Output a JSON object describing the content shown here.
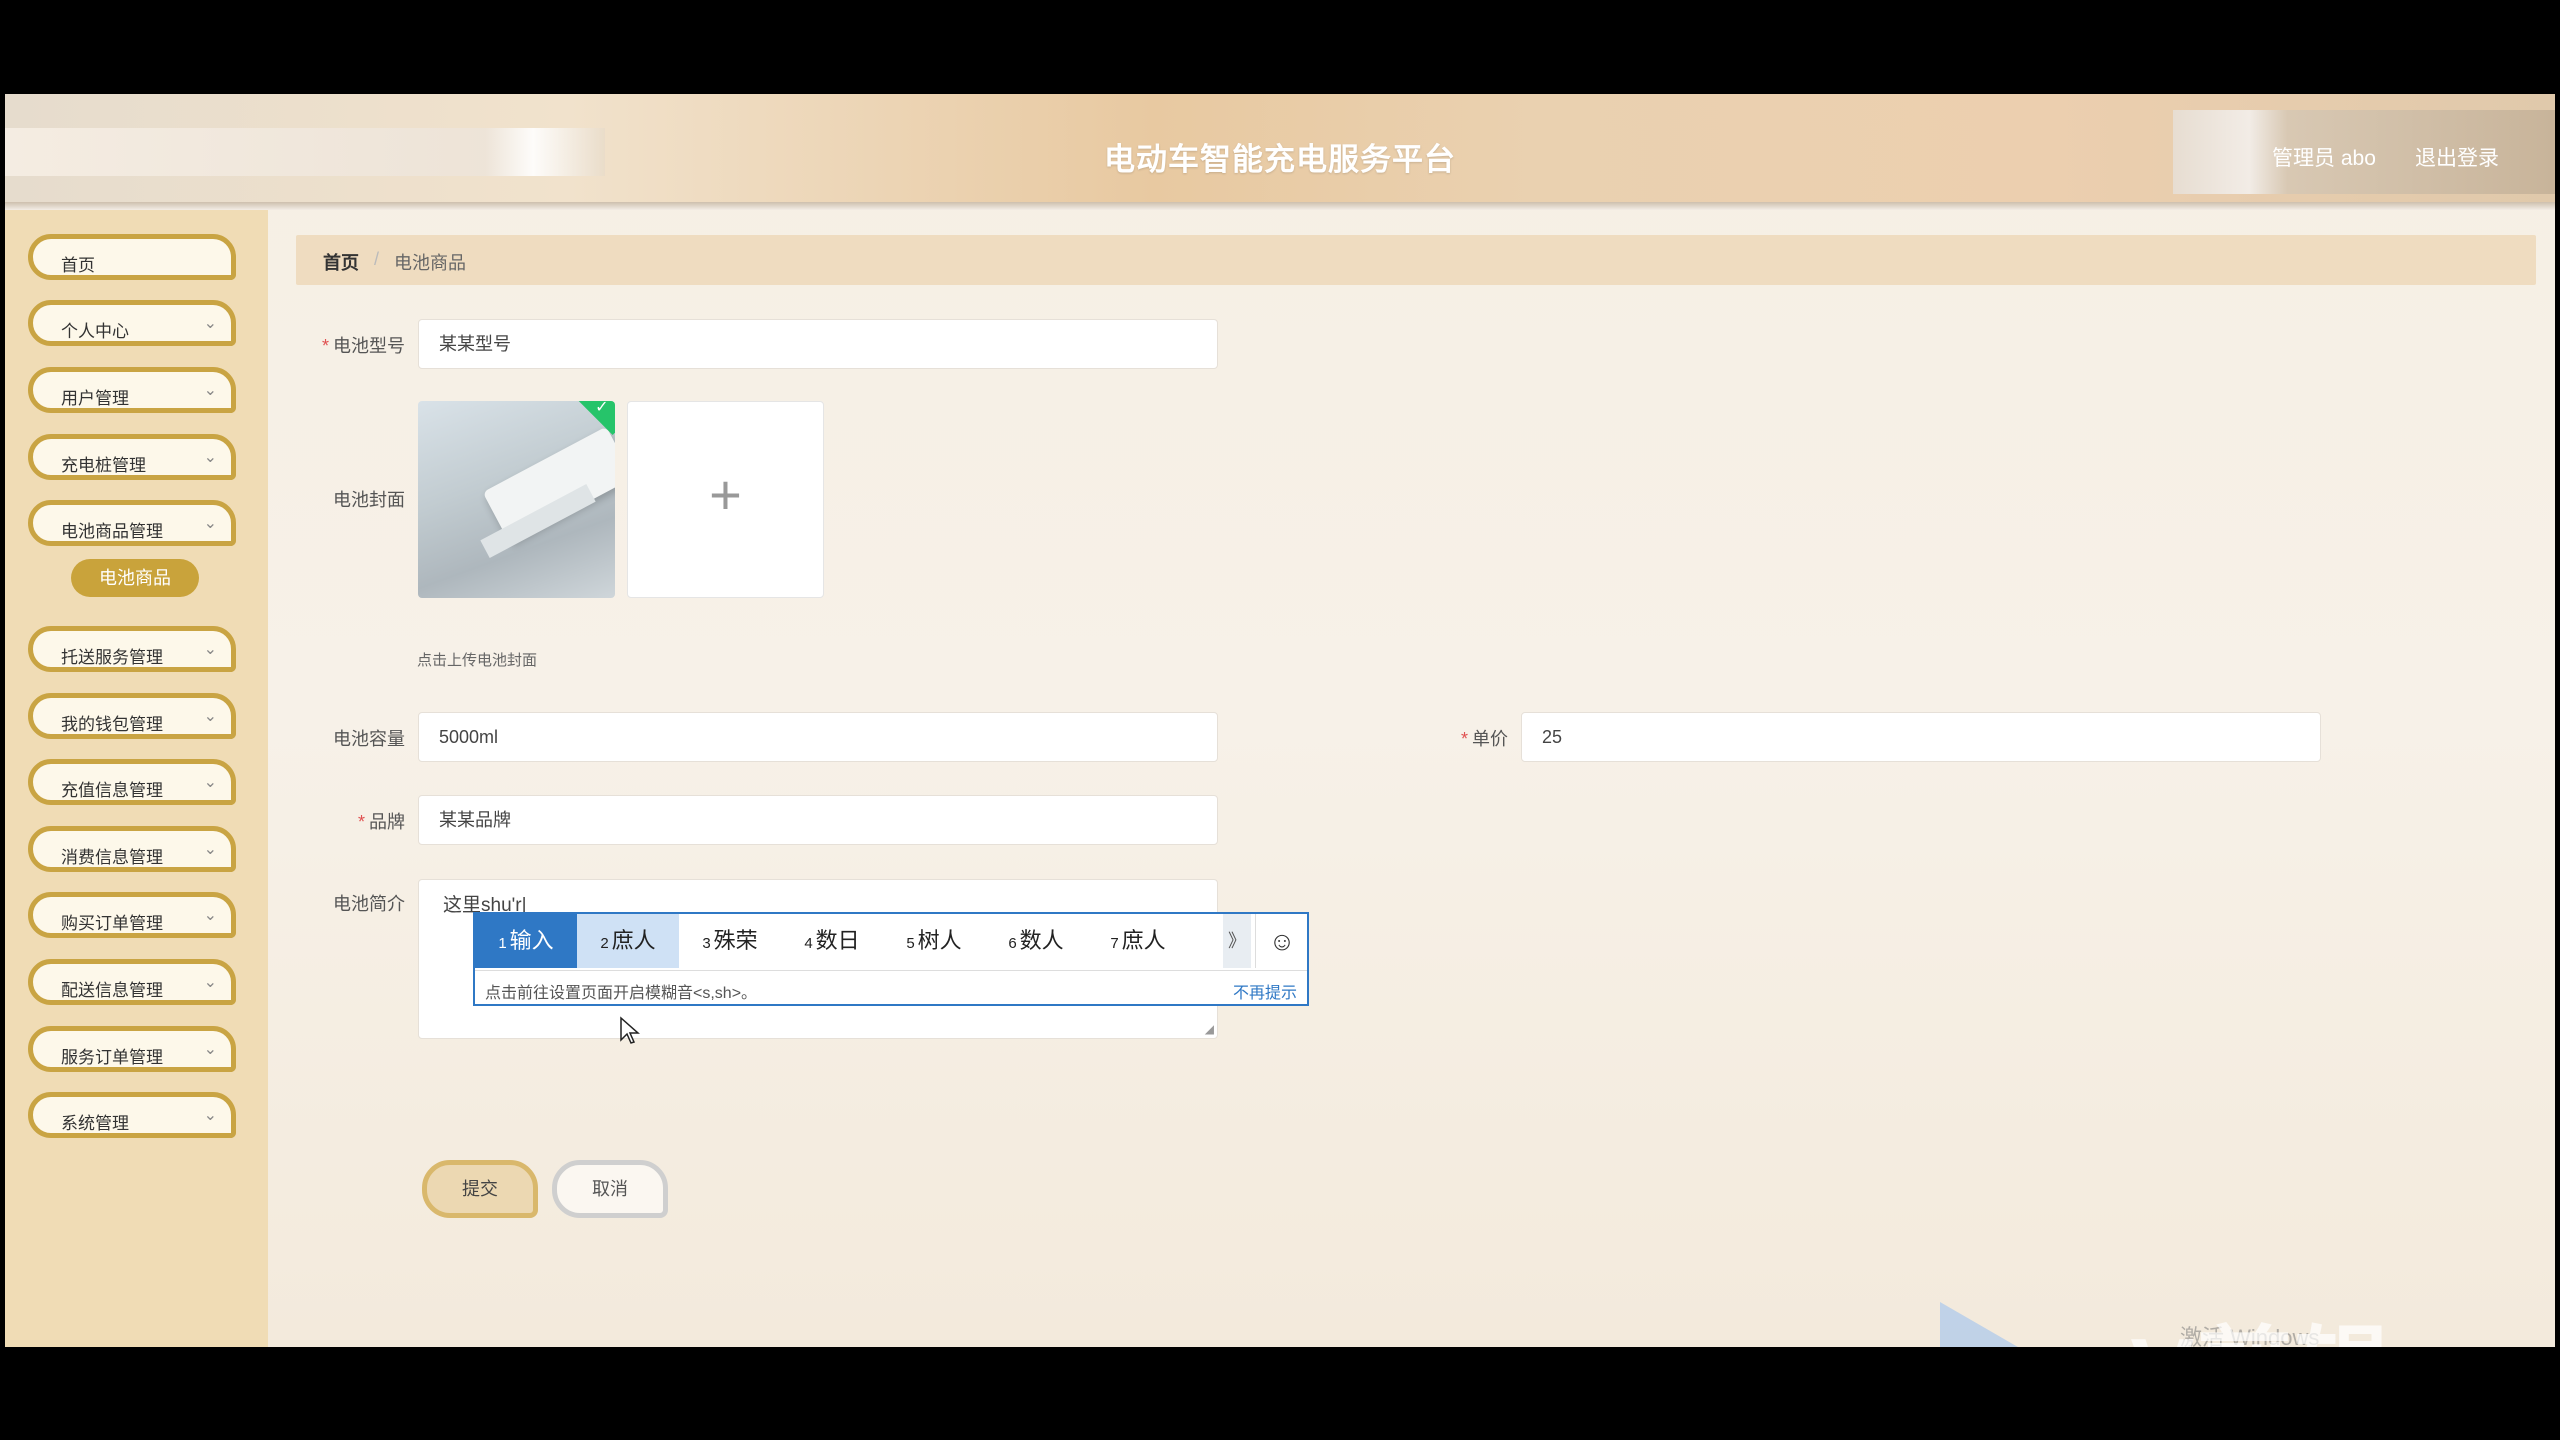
{
  "header": {
    "title": "电动车智能充电服务平台",
    "admin_label": "管理员 abo",
    "logout_label": "退出登录"
  },
  "sidebar": {
    "items": [
      {
        "label": "首页",
        "expandable": false
      },
      {
        "label": "个人中心",
        "expandable": true
      },
      {
        "label": "用户管理",
        "expandable": true
      },
      {
        "label": "充电桩管理",
        "expandable": true
      },
      {
        "label": "电池商品管理",
        "expandable": true
      },
      {
        "label": "托送服务管理",
        "expandable": true
      },
      {
        "label": "我的钱包管理",
        "expandable": true
      },
      {
        "label": "充值信息管理",
        "expandable": true
      },
      {
        "label": "消费信息管理",
        "expandable": true
      },
      {
        "label": "购买订单管理",
        "expandable": true
      },
      {
        "label": "配送信息管理",
        "expandable": true
      },
      {
        "label": "服务订单管理",
        "expandable": true
      },
      {
        "label": "系统管理",
        "expandable": true
      }
    ],
    "active_sub_item": "电池商品",
    "chevron_icon": "chevron-down-icon"
  },
  "breadcrumb": {
    "home": "首页",
    "separator": "/",
    "current": "电池商品"
  },
  "form": {
    "battery_model": {
      "label": "电池型号",
      "required": true,
      "value": "某某型号"
    },
    "battery_cover": {
      "label": "电池封面",
      "upload_hint": "点击上传电池封面",
      "add_icon": "+",
      "uploaded_check": "✓"
    },
    "battery_capacity": {
      "label": "电池容量",
      "required": false,
      "value": "5000ml"
    },
    "unit_price": {
      "label": "单价",
      "required": true,
      "value": "25"
    },
    "brand": {
      "label": "品牌",
      "required": true,
      "value": "某某品牌"
    },
    "battery_intro": {
      "label": "电池简介",
      "value": "这里shu'r|"
    },
    "submit_label": "提交",
    "cancel_label": "取消"
  },
  "ime": {
    "candidates": [
      {
        "num": "1",
        "text": "输入"
      },
      {
        "num": "2",
        "text": "庶人"
      },
      {
        "num": "3",
        "text": "殊荣"
      },
      {
        "num": "4",
        "text": "数日"
      },
      {
        "num": "5",
        "text": "树人"
      },
      {
        "num": "6",
        "text": "数人"
      },
      {
        "num": "7",
        "text": "庶人"
      }
    ],
    "selected_index": 0,
    "more_icon": "》",
    "emoji_icon": "☺",
    "tip": "点击前往设置页面开启模糊音<s,sh>。",
    "dismiss": "不再提示"
  },
  "watermark": {
    "text": "eV剪辑",
    "activate": "激活 Windows"
  },
  "colors": {
    "accent_gold": "#c9a443",
    "sidebar_bg": "#f0dcb5",
    "ime_blue": "#2f78c5",
    "required_red": "#e05050"
  }
}
